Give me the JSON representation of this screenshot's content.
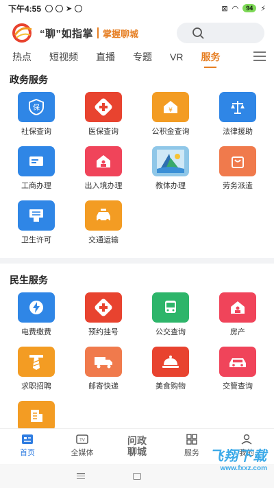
{
  "status_bar": {
    "time": "下午4:55",
    "battery": "94"
  },
  "header": {
    "brand": "“聊”如指掌",
    "sub": "掌握聊城"
  },
  "tabs": [
    {
      "label": "热点"
    },
    {
      "label": "短视频"
    },
    {
      "label": "直播"
    },
    {
      "label": "专题"
    },
    {
      "label": "VR"
    },
    {
      "label": "服务",
      "active": true
    }
  ],
  "sections": {
    "gov": {
      "title": "政务服务",
      "items": [
        {
          "label": "社保查询",
          "icon": "shield-icon",
          "color": "#2f86e6"
        },
        {
          "label": "医保查询",
          "icon": "medical-cross-icon",
          "color": "#e8432f"
        },
        {
          "label": "公积金查询",
          "icon": "house-yen-icon",
          "color": "#f39c23"
        },
        {
          "label": "法律援助",
          "icon": "scales-icon",
          "color": "#2f86e6"
        },
        {
          "label": "工商办理",
          "icon": "id-card-icon",
          "color": "#2f86e6"
        },
        {
          "label": "出入境办理",
          "icon": "house-icon",
          "color": "#f0445a"
        },
        {
          "label": "教体办理",
          "icon": "education-image-icon",
          "color": "#8fc7e8"
        },
        {
          "label": "劳务派遣",
          "icon": "shopping-bag-icon",
          "color": "#f07a4c"
        },
        {
          "label": "卫生许可",
          "icon": "certificate-icon",
          "color": "#2f86e6"
        },
        {
          "label": "交通运输",
          "icon": "taxi-icon",
          "color": "#f39c23"
        }
      ]
    },
    "life": {
      "title": "民生服务",
      "items": [
        {
          "label": "电费缴费",
          "icon": "lightning-icon",
          "color": "#2f86e6"
        },
        {
          "label": "预约挂号",
          "icon": "medical-cross-icon",
          "color": "#e8432f"
        },
        {
          "label": "公交查询",
          "icon": "bus-icon",
          "color": "#2db56a"
        },
        {
          "label": "房产",
          "icon": "house-icon",
          "color": "#f0445a"
        },
        {
          "label": "求职招聘",
          "icon": "tie-icon",
          "color": "#f39c23"
        },
        {
          "label": "邮寄快递",
          "icon": "truck-icon",
          "color": "#f07a4c"
        },
        {
          "label": "美食购物",
          "icon": "food-cloche-icon",
          "color": "#e8432f"
        },
        {
          "label": "交管查询",
          "icon": "car-icon",
          "color": "#f0445a"
        },
        {
          "label": "",
          "icon": "building-icon",
          "color": "#f39c23"
        }
      ]
    }
  },
  "bottom_nav": {
    "home": "首页",
    "media": "全媒体",
    "center": [
      "问政",
      "聊城"
    ],
    "service": "服务",
    "mine": "我的"
  },
  "watermark": {
    "text": "飞翔下载",
    "url": "www.fxxz.com"
  }
}
